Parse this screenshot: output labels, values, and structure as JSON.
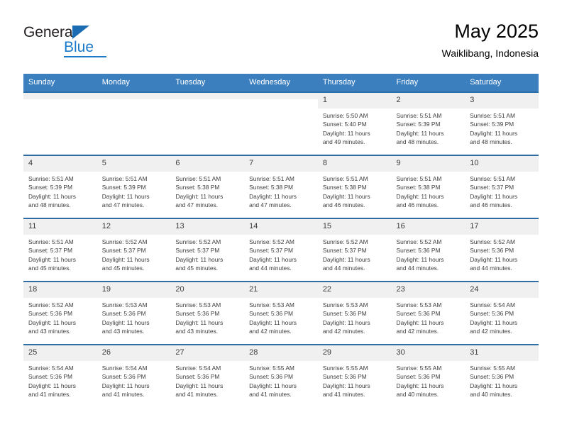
{
  "brand": {
    "name_top": "General",
    "name_bottom": "Blue",
    "triangle_color": "#1b6cb3",
    "blue_color": "#1b79c9"
  },
  "header": {
    "title": "May 2025",
    "subtitle": "Waiklibang, Indonesia",
    "header_bg": "#3b7fbf",
    "row_divider": "#2e6da4",
    "daynum_bg": "#f0f0f0"
  },
  "weekdays": [
    "Sunday",
    "Monday",
    "Tuesday",
    "Wednesday",
    "Thursday",
    "Friday",
    "Saturday"
  ],
  "labels": {
    "sunrise_prefix": "Sunrise:",
    "sunset_prefix": "Sunset:",
    "daylight_prefix": "Daylight:"
  },
  "weeks": [
    [
      {
        "day": "",
        "blank": true
      },
      {
        "day": "",
        "blank": true
      },
      {
        "day": "",
        "blank": true
      },
      {
        "day": "",
        "blank": true
      },
      {
        "day": "1",
        "sunrise": "Sunrise: 5:50 AM",
        "sunset": "Sunset: 5:40 PM",
        "daylight_1": "Daylight: 11 hours",
        "daylight_2": "and 49 minutes."
      },
      {
        "day": "2",
        "sunrise": "Sunrise: 5:51 AM",
        "sunset": "Sunset: 5:39 PM",
        "daylight_1": "Daylight: 11 hours",
        "daylight_2": "and 48 minutes."
      },
      {
        "day": "3",
        "sunrise": "Sunrise: 5:51 AM",
        "sunset": "Sunset: 5:39 PM",
        "daylight_1": "Daylight: 11 hours",
        "daylight_2": "and 48 minutes."
      }
    ],
    [
      {
        "day": "4",
        "sunrise": "Sunrise: 5:51 AM",
        "sunset": "Sunset: 5:39 PM",
        "daylight_1": "Daylight: 11 hours",
        "daylight_2": "and 48 minutes."
      },
      {
        "day": "5",
        "sunrise": "Sunrise: 5:51 AM",
        "sunset": "Sunset: 5:39 PM",
        "daylight_1": "Daylight: 11 hours",
        "daylight_2": "and 47 minutes."
      },
      {
        "day": "6",
        "sunrise": "Sunrise: 5:51 AM",
        "sunset": "Sunset: 5:38 PM",
        "daylight_1": "Daylight: 11 hours",
        "daylight_2": "and 47 minutes."
      },
      {
        "day": "7",
        "sunrise": "Sunrise: 5:51 AM",
        "sunset": "Sunset: 5:38 PM",
        "daylight_1": "Daylight: 11 hours",
        "daylight_2": "and 47 minutes."
      },
      {
        "day": "8",
        "sunrise": "Sunrise: 5:51 AM",
        "sunset": "Sunset: 5:38 PM",
        "daylight_1": "Daylight: 11 hours",
        "daylight_2": "and 46 minutes."
      },
      {
        "day": "9",
        "sunrise": "Sunrise: 5:51 AM",
        "sunset": "Sunset: 5:38 PM",
        "daylight_1": "Daylight: 11 hours",
        "daylight_2": "and 46 minutes."
      },
      {
        "day": "10",
        "sunrise": "Sunrise: 5:51 AM",
        "sunset": "Sunset: 5:37 PM",
        "daylight_1": "Daylight: 11 hours",
        "daylight_2": "and 46 minutes."
      }
    ],
    [
      {
        "day": "11",
        "sunrise": "Sunrise: 5:51 AM",
        "sunset": "Sunset: 5:37 PM",
        "daylight_1": "Daylight: 11 hours",
        "daylight_2": "and 45 minutes."
      },
      {
        "day": "12",
        "sunrise": "Sunrise: 5:52 AM",
        "sunset": "Sunset: 5:37 PM",
        "daylight_1": "Daylight: 11 hours",
        "daylight_2": "and 45 minutes."
      },
      {
        "day": "13",
        "sunrise": "Sunrise: 5:52 AM",
        "sunset": "Sunset: 5:37 PM",
        "daylight_1": "Daylight: 11 hours",
        "daylight_2": "and 45 minutes."
      },
      {
        "day": "14",
        "sunrise": "Sunrise: 5:52 AM",
        "sunset": "Sunset: 5:37 PM",
        "daylight_1": "Daylight: 11 hours",
        "daylight_2": "and 44 minutes."
      },
      {
        "day": "15",
        "sunrise": "Sunrise: 5:52 AM",
        "sunset": "Sunset: 5:37 PM",
        "daylight_1": "Daylight: 11 hours",
        "daylight_2": "and 44 minutes."
      },
      {
        "day": "16",
        "sunrise": "Sunrise: 5:52 AM",
        "sunset": "Sunset: 5:36 PM",
        "daylight_1": "Daylight: 11 hours",
        "daylight_2": "and 44 minutes."
      },
      {
        "day": "17",
        "sunrise": "Sunrise: 5:52 AM",
        "sunset": "Sunset: 5:36 PM",
        "daylight_1": "Daylight: 11 hours",
        "daylight_2": "and 44 minutes."
      }
    ],
    [
      {
        "day": "18",
        "sunrise": "Sunrise: 5:52 AM",
        "sunset": "Sunset: 5:36 PM",
        "daylight_1": "Daylight: 11 hours",
        "daylight_2": "and 43 minutes."
      },
      {
        "day": "19",
        "sunrise": "Sunrise: 5:53 AM",
        "sunset": "Sunset: 5:36 PM",
        "daylight_1": "Daylight: 11 hours",
        "daylight_2": "and 43 minutes."
      },
      {
        "day": "20",
        "sunrise": "Sunrise: 5:53 AM",
        "sunset": "Sunset: 5:36 PM",
        "daylight_1": "Daylight: 11 hours",
        "daylight_2": "and 43 minutes."
      },
      {
        "day": "21",
        "sunrise": "Sunrise: 5:53 AM",
        "sunset": "Sunset: 5:36 PM",
        "daylight_1": "Daylight: 11 hours",
        "daylight_2": "and 42 minutes."
      },
      {
        "day": "22",
        "sunrise": "Sunrise: 5:53 AM",
        "sunset": "Sunset: 5:36 PM",
        "daylight_1": "Daylight: 11 hours",
        "daylight_2": "and 42 minutes."
      },
      {
        "day": "23",
        "sunrise": "Sunrise: 5:53 AM",
        "sunset": "Sunset: 5:36 PM",
        "daylight_1": "Daylight: 11 hours",
        "daylight_2": "and 42 minutes."
      },
      {
        "day": "24",
        "sunrise": "Sunrise: 5:54 AM",
        "sunset": "Sunset: 5:36 PM",
        "daylight_1": "Daylight: 11 hours",
        "daylight_2": "and 42 minutes."
      }
    ],
    [
      {
        "day": "25",
        "sunrise": "Sunrise: 5:54 AM",
        "sunset": "Sunset: 5:36 PM",
        "daylight_1": "Daylight: 11 hours",
        "daylight_2": "and 41 minutes."
      },
      {
        "day": "26",
        "sunrise": "Sunrise: 5:54 AM",
        "sunset": "Sunset: 5:36 PM",
        "daylight_1": "Daylight: 11 hours",
        "daylight_2": "and 41 minutes."
      },
      {
        "day": "27",
        "sunrise": "Sunrise: 5:54 AM",
        "sunset": "Sunset: 5:36 PM",
        "daylight_1": "Daylight: 11 hours",
        "daylight_2": "and 41 minutes."
      },
      {
        "day": "28",
        "sunrise": "Sunrise: 5:55 AM",
        "sunset": "Sunset: 5:36 PM",
        "daylight_1": "Daylight: 11 hours",
        "daylight_2": "and 41 minutes."
      },
      {
        "day": "29",
        "sunrise": "Sunrise: 5:55 AM",
        "sunset": "Sunset: 5:36 PM",
        "daylight_1": "Daylight: 11 hours",
        "daylight_2": "and 41 minutes."
      },
      {
        "day": "30",
        "sunrise": "Sunrise: 5:55 AM",
        "sunset": "Sunset: 5:36 PM",
        "daylight_1": "Daylight: 11 hours",
        "daylight_2": "and 40 minutes."
      },
      {
        "day": "31",
        "sunrise": "Sunrise: 5:55 AM",
        "sunset": "Sunset: 5:36 PM",
        "daylight_1": "Daylight: 11 hours",
        "daylight_2": "and 40 minutes."
      }
    ]
  ]
}
